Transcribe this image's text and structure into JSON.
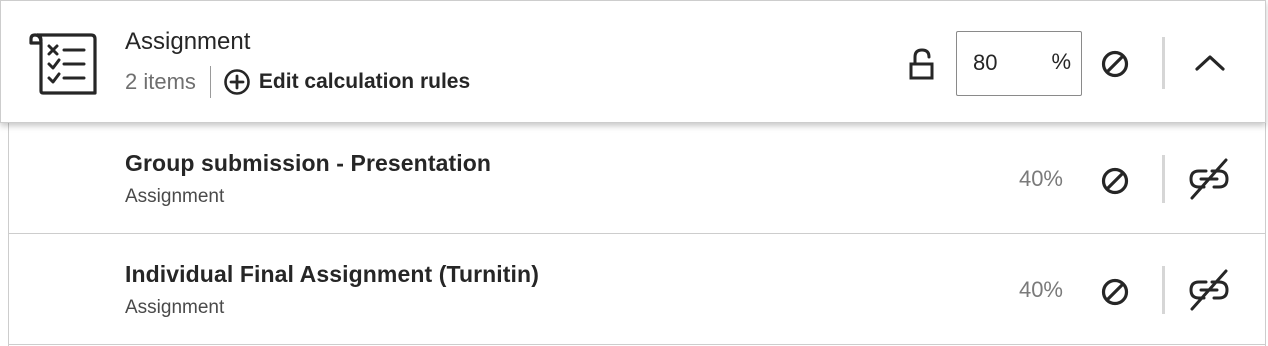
{
  "category": {
    "title": "Assignment",
    "item_count": "2 items",
    "edit_rules_label": "Edit calculation rules",
    "weight_value": "80",
    "weight_unit": "%",
    "icon": "checklist-icon",
    "lock_icon": "unlock-icon",
    "exempt_icon": "exempt-icon",
    "expand_icon": "chevron-up-icon"
  },
  "items": [
    {
      "title": "Group submission - Presentation",
      "type": "Assignment",
      "weight": "40%",
      "exempt_icon": "exempt-icon",
      "link_icon": "link-off-icon"
    },
    {
      "title": "Individual Final Assignment (Turnitin)",
      "type": "Assignment",
      "weight": "40%",
      "exempt_icon": "exempt-icon",
      "link_icon": "link-off-icon"
    }
  ],
  "colors": {
    "text": "#262626",
    "muted": "#6f6f6f",
    "border": "#cdcdcd"
  }
}
